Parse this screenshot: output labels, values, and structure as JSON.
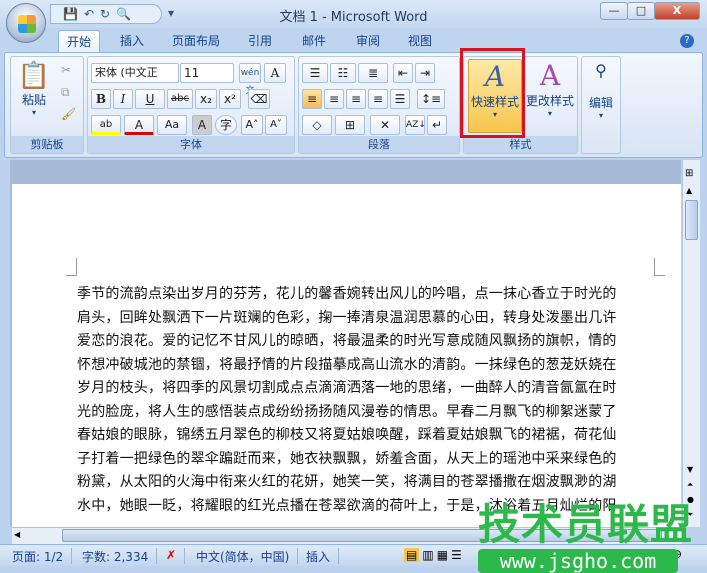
{
  "window": {
    "title": "文档 1 - Microsoft Word",
    "minimize": "—",
    "maximize": "□",
    "close": "X"
  },
  "qat": {
    "save": "💾",
    "undo": "↶",
    "redo": "↻",
    "preview": "🔍",
    "customize": "▾"
  },
  "tabs": [
    {
      "label": "开始",
      "active": true
    },
    {
      "label": "插入"
    },
    {
      "label": "页面布局"
    },
    {
      "label": "引用"
    },
    {
      "label": "邮件"
    },
    {
      "label": "审阅"
    },
    {
      "label": "视图"
    }
  ],
  "help": "?",
  "ribbon": {
    "clipboard": {
      "label": "剪贴板",
      "paste": "粘贴"
    },
    "font": {
      "label": "字体",
      "font_name": "宋体 (中文正",
      "font_size": "11",
      "bold": "B",
      "italic": "I",
      "underline": "U",
      "strike": "abc",
      "sub": "x₂",
      "sup": "x²",
      "phonetic": "wén 文",
      "border": "A",
      "highlight": "ab",
      "color": "A",
      "case": "Aa",
      "shade": "A",
      "enclose": "字",
      "grow": "A˄",
      "shrink": "A˅"
    },
    "paragraph": {
      "label": "段落"
    },
    "styles": {
      "label": "样式",
      "quick": "快速样式",
      "change": "更改样式"
    },
    "editing": {
      "label": "编辑"
    }
  },
  "document": {
    "lines": [
      "季节的流韵点染出岁月的芬芳，花儿的馨香婉转出风儿的吟唱，点一抹心香立于时光的",
      "肩头，回眸处飘洒下一片斑斓的色彩，掬一捧清泉温润思慕的心田，转身处泼墨出几许",
      "爱恋的浪花。爱的记忆不甘风儿的晾晒，将最温柔的时光写意成随风飘扬的旗帜，情的",
      "怀想冲破城池的禁锢，将最抒情的片段描摹成高山流水的清韵。一抹绿色的葱茏妖娆在",
      "岁月的枝头，将四季的风景切割成点点滴滴洒落一地的思绪，一曲醉人的清音氤氲在时",
      "光的脸庞，将人生的感悟装点成纷纷扬扬随风漫卷的情思。早春二月飘飞的柳絮迷蒙了",
      "春姑娘的眼脉，锦绣五月翠色的柳枝又将夏姑娘唤醒，踩着夏姑娘飘飞的裙裾，荷花仙",
      "子打着一把绿色的翠伞蹁跹而来，她衣袂飘飘，娇羞含面，从天上的瑶池中采来绿色的",
      "粉黛，从太阳的火海中衔来火红的花妍，她笑一笑，将满目的苍翠播撒在烟波飘渺的湖",
      "水中，她眼一眨，将耀眼的红光点播在苍翠欲滴的荷叶上，于是，沐浴着五月灿烂的阳"
    ]
  },
  "status": {
    "page": "页面: 1/2",
    "words": "字数: 2,334",
    "language": "中文(简体，中国)",
    "mode": "插入"
  },
  "watermark": {
    "text": "技术员联盟",
    "url": "www.jsgho.com"
  },
  "colors": {
    "highlight_box": "#d8121e",
    "accent": "#15428b"
  }
}
